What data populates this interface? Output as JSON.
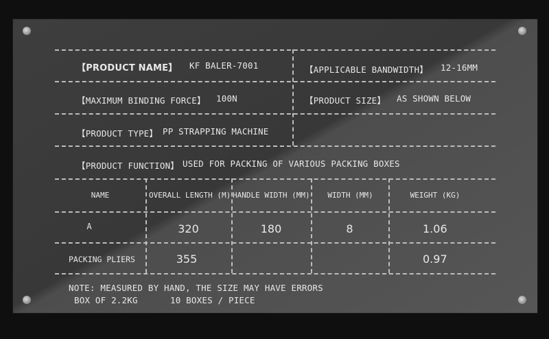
{
  "spec": {
    "product_name_label": "【PRODUCT NAME】",
    "product_name_value": "KF BALER-7001",
    "bandwidth_label": "【APPLICABLE BANDWIDTH】",
    "bandwidth_value": "12-16MM",
    "force_label": "【MAXIMUM BINDING FORCE】",
    "force_value": "100N",
    "size_label": "【PRODUCT SIZE】",
    "size_value": "AS SHOWN BELOW",
    "type_label": "【PRODUCT TYPE】",
    "type_value": "PP STRAPPING MACHINE",
    "function_label": "【PRODUCT FUNCTION】",
    "function_value": "USED FOR PACKING OF VARIOUS PACKING BOXES"
  },
  "table": {
    "headers": [
      "NAME",
      "OVERALL LENGTH (M)",
      "HANDLE WIDTH (MM)",
      "WIDTH (MM)",
      "WEIGHT (KG)"
    ],
    "rows": [
      [
        "A",
        "320",
        "180",
        "8",
        "1.06"
      ],
      [
        "PACKING PLIERS",
        "355",
        "",
        "",
        "0.97"
      ]
    ]
  },
  "notes": {
    "line1": "NOTE: MEASURED BY HAND, THE SIZE MAY HAVE ERRORS",
    "line2_a": "BOX OF 2.2KG",
    "line2_b": "10 BOXES / PIECE"
  }
}
